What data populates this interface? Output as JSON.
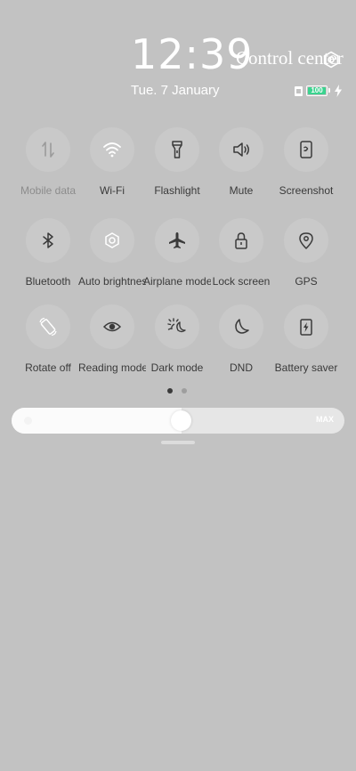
{
  "header": {
    "time": "12:39",
    "title": "Control center",
    "date": "Tue. 7 January",
    "battery_level": "100",
    "battery_color": "#3bd38f"
  },
  "tiles": [
    {
      "label": "Mobile data",
      "icon": "mobile-data-icon",
      "enabled": false
    },
    {
      "label": "Wi-Fi",
      "icon": "wifi-icon",
      "enabled": true
    },
    {
      "label": "Flashlight",
      "icon": "flashlight-icon",
      "enabled": true
    },
    {
      "label": "Mute",
      "icon": "speaker-icon",
      "enabled": true
    },
    {
      "label": "Screenshot",
      "icon": "screenshot-icon",
      "enabled": true
    },
    {
      "label": "Bluetooth",
      "icon": "bluetooth-icon",
      "enabled": true
    },
    {
      "label": "Auto brightness",
      "icon": "brightness-auto-icon",
      "enabled": true
    },
    {
      "label": "Airplane mode",
      "icon": "airplane-icon",
      "enabled": true
    },
    {
      "label": "Lock screen",
      "icon": "lock-icon",
      "enabled": true
    },
    {
      "label": "GPS",
      "icon": "location-pin-icon",
      "enabled": true
    },
    {
      "label": "Rotate off",
      "icon": "rotate-icon",
      "enabled": true
    },
    {
      "label": "Reading mode",
      "icon": "eye-icon",
      "enabled": true
    },
    {
      "label": "Dark mode",
      "icon": "dark-mode-icon",
      "enabled": true
    },
    {
      "label": "DND",
      "icon": "moon-icon",
      "enabled": true
    },
    {
      "label": "Battery saver",
      "icon": "battery-saver-icon",
      "enabled": true
    }
  ],
  "pager": {
    "pages": 2,
    "current": 1
  },
  "brightness": {
    "level": 0.51,
    "max_label": "MAX"
  }
}
